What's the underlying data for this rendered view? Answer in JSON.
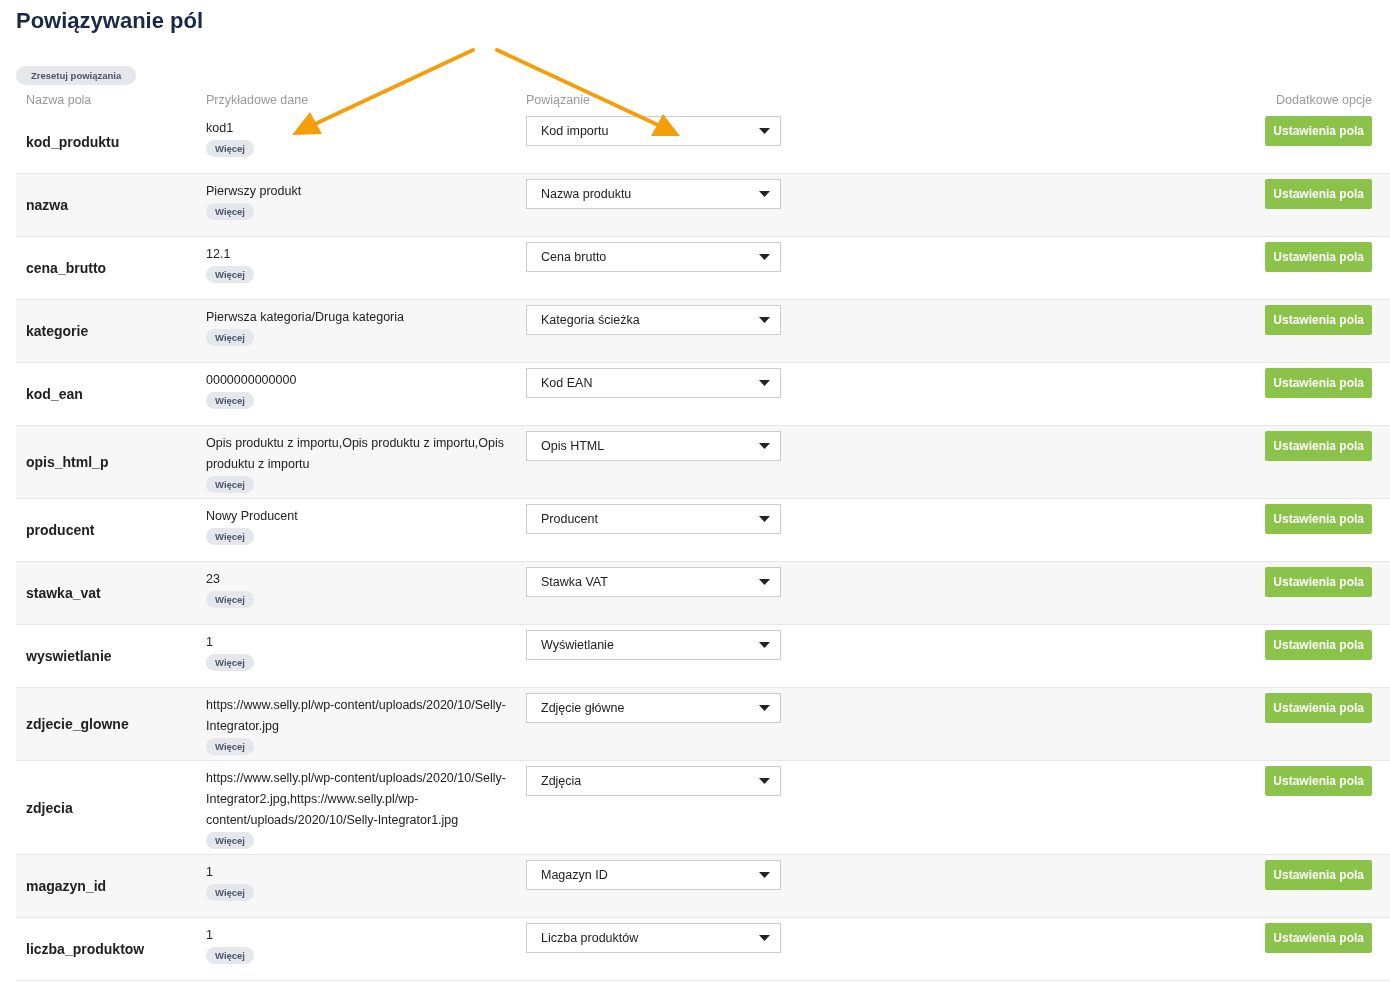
{
  "title": "Powiązywanie pól",
  "reset_button": "Zresetuj powiązania",
  "table": {
    "columns": [
      "Nazwa pola",
      "Przykładowe dane",
      "Powiązanie",
      "Dodatkowe opcje"
    ],
    "rows": [
      {
        "name": "kod_produktu",
        "sample": "kod1",
        "more": "Więcej",
        "mapping": "Kod importu",
        "action": "Ustawienia pola"
      },
      {
        "name": "nazwa",
        "sample": "Pierwszy produkt",
        "more": "Więcej",
        "mapping": "Nazwa produktu",
        "action": "Ustawienia pola"
      },
      {
        "name": "cena_brutto",
        "sample": "12.1",
        "more": "Więcej",
        "mapping": "Cena brutto",
        "action": "Ustawienia pola"
      },
      {
        "name": "kategorie",
        "sample": "Pierwsza kategoria/Druga kategoria",
        "more": "Więcej",
        "mapping": "Kategoria ścieżka",
        "action": "Ustawienia pola"
      },
      {
        "name": "kod_ean",
        "sample": "0000000000000",
        "more": "Więcej",
        "mapping": "Kod EAN",
        "action": "Ustawienia pola"
      },
      {
        "name": "opis_html_p",
        "sample": "Opis produktu z importu,Opis produktu z importu,Opis produktu z importu",
        "more": "Więcej",
        "mapping": "Opis HTML",
        "action": "Ustawienia pola"
      },
      {
        "name": "producent",
        "sample": "Nowy Producent",
        "more": "Więcej",
        "mapping": "Producent",
        "action": "Ustawienia pola"
      },
      {
        "name": "stawka_vat",
        "sample": "23",
        "more": "Więcej",
        "mapping": "Stawka VAT",
        "action": "Ustawienia pola"
      },
      {
        "name": "wyswietlanie",
        "sample": "1",
        "more": "Więcej",
        "mapping": "Wyświetlanie",
        "action": "Ustawienia pola"
      },
      {
        "name": "zdjecie_glowne",
        "sample": "https://www.selly.pl/wp-content/uploads/2020/10/Selly-Integrator.jpg",
        "more": "Więcej",
        "mapping": "Zdjęcie główne",
        "action": "Ustawienia pola"
      },
      {
        "name": "zdjecia",
        "sample": "https://www.selly.pl/wp-content/uploads/2020/10/Selly-Integrator2.jpg,https://www.selly.pl/wp-content/uploads/2020/10/Selly-Integrator1.jpg",
        "more": "Więcej",
        "mapping": "Zdjęcia",
        "action": "Ustawienia pola"
      },
      {
        "name": "magazyn_id",
        "sample": "1",
        "more": "Więcej",
        "mapping": "Magazyn ID",
        "action": "Ustawienia pola"
      },
      {
        "name": "liczba_produktow",
        "sample": "1",
        "more": "Więcej",
        "mapping": "Liczba produktów",
        "action": "Ustawienia pola"
      }
    ]
  }
}
